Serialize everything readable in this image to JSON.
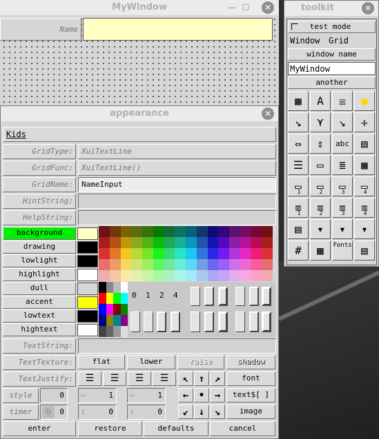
{
  "colors": {
    "accent_green": "#00ee00",
    "light_yellow": "#ffffc4",
    "yellow": "#ffff00",
    "desktop": "#2e2e2e",
    "window_bg": "#d6d6d6"
  },
  "mywindow": {
    "title": "MyWindow",
    "name_label": "Name",
    "name_value": ""
  },
  "toolkit": {
    "title": "toolkit",
    "test_mode_label": "test mode",
    "menu_window": "Window",
    "menu_grid": "Grid",
    "window_name_label": "window name",
    "window_name_value": "MyWindow",
    "another_label": "another",
    "tool_icons": [
      "palette-icon",
      "text-icon",
      "checkbox-icon",
      "radio-icon",
      "arrow-se-icon",
      "arrows-merge-icon",
      "arrow-se-icon",
      "cross-arrows-icon",
      "hscroll-icon",
      "vscroll-icon",
      "abc-icon",
      "textarea-icon",
      "list-icon",
      "menu-icon",
      "listbox-icon",
      "textbox-icon",
      "grid1-icon",
      "grid2-icon",
      "grid3-icon",
      "grid4-icon",
      "grid1b-icon",
      "grid2b-icon",
      "grid3b-icon",
      "grid4b-icon",
      "panel-icon",
      "dropdown-icon",
      "dropdown2-icon",
      "dropdown3-icon",
      "number-icon",
      "table-icon",
      "fonts-icon",
      "document-icon"
    ],
    "grid_nums": [
      "1",
      "2",
      "3",
      "4"
    ],
    "fonts_label": "Fonts"
  },
  "appearance": {
    "title": "appearance",
    "kids_label": "Kids",
    "grid_type_label": "GridType:",
    "grid_type_value": "XuiTextLine",
    "grid_func_label": "GridFunc:",
    "grid_func_value": "XuiTextLine()",
    "grid_name_label": "GridName:",
    "grid_name_value": "NameInput",
    "hint_label": "HintString:",
    "help_label": "HelpString:",
    "color_buttons": [
      {
        "label": "background",
        "swatch": "#ffffc4",
        "active": true
      },
      {
        "label": "drawing",
        "swatch": "#000000"
      },
      {
        "label": "lowlight",
        "swatch": "#000000"
      },
      {
        "label": "highlight",
        "swatch": "#ffffff"
      },
      {
        "label": "dull",
        "swatch": "#d6d6d6"
      },
      {
        "label": "accent",
        "swatch": "#ffff00"
      },
      {
        "label": "lowtext",
        "swatch": "#000000"
      },
      {
        "label": "hightext",
        "swatch": "#ffffff"
      }
    ],
    "border_nums": [
      "0",
      "1",
      "2",
      "4"
    ],
    "text_string_label": "TextString:",
    "text_texture_label": "TextTexture:",
    "texture_options": [
      "flat",
      "lower",
      "raise",
      "shadow"
    ],
    "text_justify_label": "TextJustify:",
    "font_label": "font",
    "style_label": "style",
    "style_value": "0",
    "spin1_value": "1",
    "spin2_value": "1",
    "textfmt_label": "text$[ ]",
    "timer_label": "timer",
    "timer_value": "0",
    "spin3_value": "0",
    "spin4_value": "0",
    "image_label": "image",
    "enter_label": "enter",
    "restore_label": "restore",
    "defaults_label": "defaults",
    "cancel_label": "cancel"
  }
}
